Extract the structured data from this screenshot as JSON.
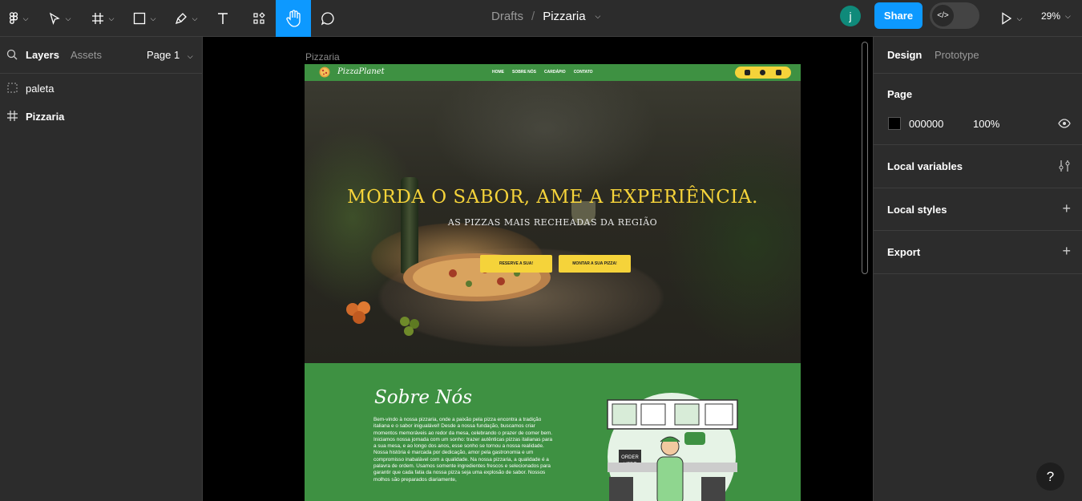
{
  "toolbar": {
    "breadcrumb_root": "Drafts",
    "breadcrumb_sep": "/",
    "file_name": "Pizzaria",
    "avatar_initial": "j",
    "share_label": "Share",
    "zoom_label": "29%",
    "active_tool": "hand-tool",
    "accent_color": "#0d99ff"
  },
  "left_panel": {
    "tabs": [
      "Layers",
      "Assets"
    ],
    "page_selector": "Page 1",
    "layers": [
      {
        "name": "paleta",
        "icon": "section-icon"
      },
      {
        "name": "Pizzaria",
        "icon": "frame-icon"
      }
    ]
  },
  "canvas": {
    "frame_label": "Pizzaria",
    "site": {
      "logo_text": "PizzaPlanet",
      "nav_links": [
        "HOME",
        "SOBRE NÓS",
        "CARDÁPIO",
        "CONTATO"
      ],
      "hero_title": "MORDA O SABOR, AME A EXPERIÊNCIA.",
      "hero_subtitle": "AS PIZZAS MAIS RECHEADAS DA REGIÃO",
      "hero_buttons": [
        "RESERVE A SUA!",
        "MONTAR A SUA PIZZA!"
      ],
      "about_title": "Sobre Nós",
      "about_text": "Bem-vindo à nossa pizzaria, onde a paixão pela pizza encontra a tradição italiana e o sabor inigualável! Desde a nossa fundação, buscamos criar momentos memoráveis ao redor da mesa, celebrando o prazer de comer bem. Iniciamos nossa jornada com um sonho: trazer autênticas pizzas italianas para a sua mesa, e ao longo dos anos, esse sonho se tornou a nossa realidade. Nossa história é marcada por dedicação, amor pela gastronomia e um compromisso inabalável com a qualidade. Na nossa pizzaria, a qualidade é a palavra de ordem. Usamos somente ingredientes frescos e selecionados para garantir que cada fatia da nossa pizza seja uma explosão de sabor. Nossos molhos são preparados diariamente,",
      "illustration_sign": "ORDER HERE",
      "brand_green": "#3e9142",
      "brand_yellow": "#f5d33a"
    }
  },
  "right_panel": {
    "tabs": [
      "Design",
      "Prototype"
    ],
    "page_label": "Page",
    "page_color_hex": "000000",
    "page_opacity": "100%",
    "local_variables_label": "Local variables",
    "local_styles_label": "Local styles",
    "export_label": "Export",
    "help_label": "?"
  }
}
